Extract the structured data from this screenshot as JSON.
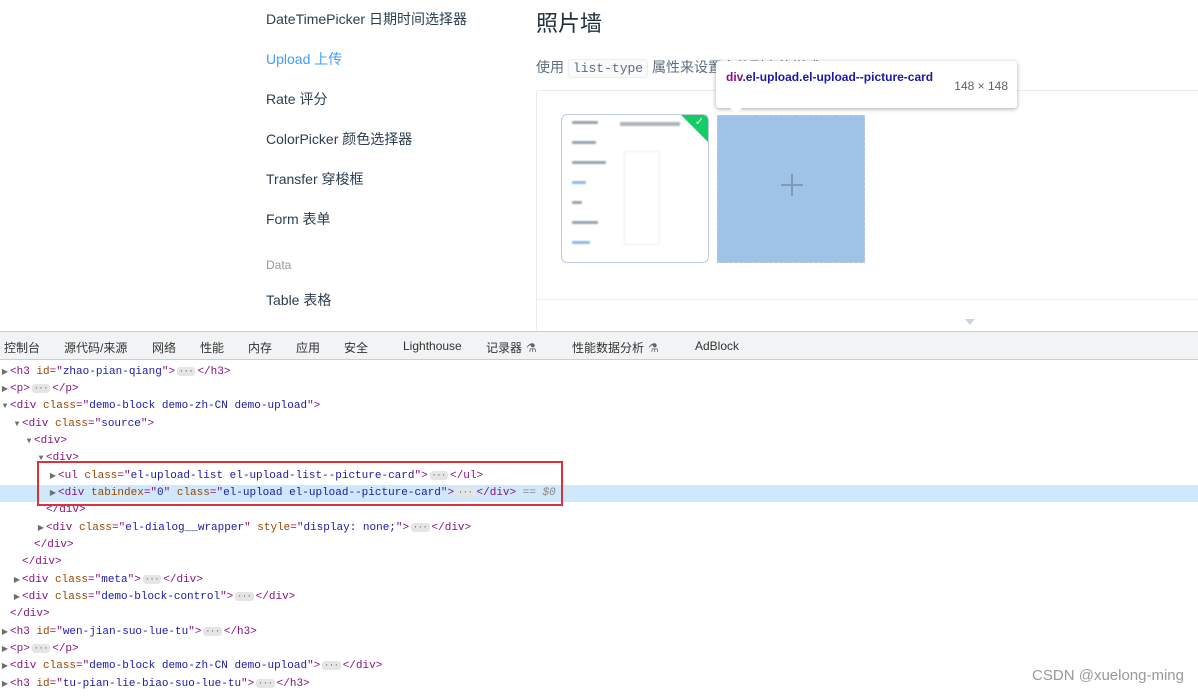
{
  "sidebar": {
    "items": [
      {
        "label": "DateTimePicker 日期时间选择器",
        "active": false
      },
      {
        "label": "Upload 上传",
        "active": true
      },
      {
        "label": "Rate 评分",
        "active": false
      },
      {
        "label": "ColorPicker 颜色选择器",
        "active": false
      },
      {
        "label": "Transfer 穿梭框",
        "active": false
      },
      {
        "label": "Form 表单",
        "active": false
      }
    ],
    "group_label": "Data",
    "group_items": [
      {
        "label": "Table 表格"
      }
    ]
  },
  "content": {
    "title": "照片墙",
    "desc_prefix": "使用",
    "desc_code": "list-type",
    "desc_suffix": "属性来设置文件列表的样式。"
  },
  "tooltip": {
    "selector_tag": "div",
    "selector_classes": ".el-upload.el-upload--picture-card",
    "size": "148 × 148"
  },
  "devtools": {
    "tabs": [
      {
        "label": "控制台"
      },
      {
        "label": "源代码/来源"
      },
      {
        "label": "网络"
      },
      {
        "label": "性能"
      },
      {
        "label": "内存"
      },
      {
        "label": "应用"
      },
      {
        "label": "安全"
      },
      {
        "label": "Lighthouse"
      },
      {
        "label": "记录器"
      },
      {
        "label": "性能数据分析"
      },
      {
        "label": "AdBlock"
      }
    ],
    "flask_icon": "⚗"
  },
  "watermark": "CSDN @xuelong-ming",
  "colors": {
    "accent": "#409eff",
    "success": "#13ce66",
    "selected_row": "#cfe8fc",
    "highlight_box": "#d9343c"
  }
}
